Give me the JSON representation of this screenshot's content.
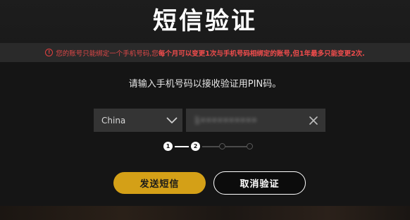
{
  "dialog": {
    "title": "短信验证",
    "warning": {
      "text_normal": "您的账号只能绑定一个手机号码,您",
      "text_strong": "每个月可以变更1次与手机号码相绑定的账号,但1年最多只能变更2次.",
      "icon": "exclamation-circle-icon"
    },
    "instruction": "请输入手机号码以接收验证用PIN码。",
    "country_select": {
      "value": "China",
      "icon": "chevron-down-icon"
    },
    "phone_input": {
      "value": "1••••••••••",
      "clear_icon": "close-icon"
    },
    "steps": {
      "current": 2,
      "total": 4,
      "labels": [
        "1",
        "2"
      ]
    },
    "buttons": {
      "send": "发送短信",
      "cancel": "取消验证"
    }
  },
  "colors": {
    "accent": "#d4a017",
    "warning": "#e04848",
    "background": "#151515",
    "field": "#343434"
  }
}
